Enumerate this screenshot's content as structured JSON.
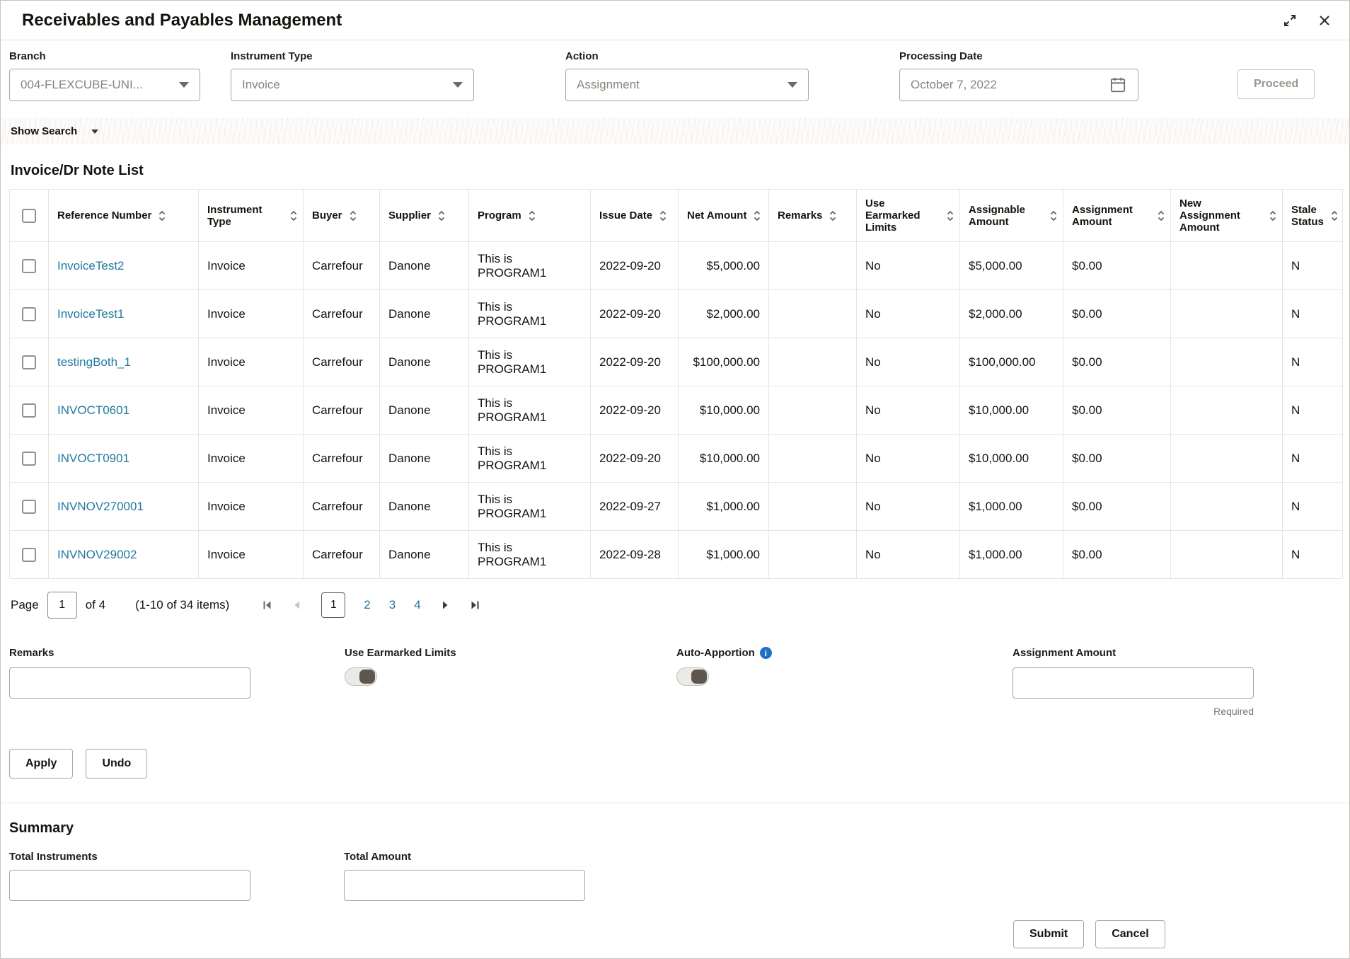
{
  "window": {
    "title": "Receivables and Payables Management"
  },
  "filters": {
    "branch": {
      "label": "Branch",
      "value": "004-FLEXCUBE-UNI..."
    },
    "instrument_type": {
      "label": "Instrument Type",
      "value": "Invoice"
    },
    "action": {
      "label": "Action",
      "value": "Assignment"
    },
    "processing_date": {
      "label": "Processing Date",
      "value": "October 7, 2022"
    },
    "proceed_label": "Proceed"
  },
  "show_search_label": "Show Search",
  "list": {
    "title": "Invoice/Dr Note List",
    "columns": [
      "Reference Number",
      "Instrument Type",
      "Buyer",
      "Supplier",
      "Program",
      "Issue Date",
      "Net Amount",
      "Remarks",
      "Use Earmarked Limits",
      "Assignable Amount",
      "Assignment Amount",
      "New Assignment Amount",
      "Stale Status"
    ],
    "rows": [
      {
        "reference": "InvoiceTest2",
        "instrument_type": "Invoice",
        "buyer": "Carrefour",
        "supplier": "Danone",
        "program": "This is PROGRAM1",
        "issue_date": "2022-09-20",
        "net_amount": "$5,000.00",
        "remarks": "",
        "use_earmarked_limits": "No",
        "assignable_amount": "$5,000.00",
        "assignment_amount": "$0.00",
        "new_assignment_amount": "",
        "stale_status": "N"
      },
      {
        "reference": "InvoiceTest1",
        "instrument_type": "Invoice",
        "buyer": "Carrefour",
        "supplier": "Danone",
        "program": "This is PROGRAM1",
        "issue_date": "2022-09-20",
        "net_amount": "$2,000.00",
        "remarks": "",
        "use_earmarked_limits": "No",
        "assignable_amount": "$2,000.00",
        "assignment_amount": "$0.00",
        "new_assignment_amount": "",
        "stale_status": "N"
      },
      {
        "reference": "testingBoth_1",
        "instrument_type": "Invoice",
        "buyer": "Carrefour",
        "supplier": "Danone",
        "program": "This is PROGRAM1",
        "issue_date": "2022-09-20",
        "net_amount": "$100,000.00",
        "remarks": "",
        "use_earmarked_limits": "No",
        "assignable_amount": "$100,000.00",
        "assignment_amount": "$0.00",
        "new_assignment_amount": "",
        "stale_status": "N"
      },
      {
        "reference": "INVOCT0601",
        "instrument_type": "Invoice",
        "buyer": "Carrefour",
        "supplier": "Danone",
        "program": "This is PROGRAM1",
        "issue_date": "2022-09-20",
        "net_amount": "$10,000.00",
        "remarks": "",
        "use_earmarked_limits": "No",
        "assignable_amount": "$10,000.00",
        "assignment_amount": "$0.00",
        "new_assignment_amount": "",
        "stale_status": "N"
      },
      {
        "reference": "INVOCT0901",
        "instrument_type": "Invoice",
        "buyer": "Carrefour",
        "supplier": "Danone",
        "program": "This is PROGRAM1",
        "issue_date": "2022-09-20",
        "net_amount": "$10,000.00",
        "remarks": "",
        "use_earmarked_limits": "No",
        "assignable_amount": "$10,000.00",
        "assignment_amount": "$0.00",
        "new_assignment_amount": "",
        "stale_status": "N"
      },
      {
        "reference": "INVNOV270001",
        "instrument_type": "Invoice",
        "buyer": "Carrefour",
        "supplier": "Danone",
        "program": "This is PROGRAM1",
        "issue_date": "2022-09-27",
        "net_amount": "$1,000.00",
        "remarks": "",
        "use_earmarked_limits": "No",
        "assignable_amount": "$1,000.00",
        "assignment_amount": "$0.00",
        "new_assignment_amount": "",
        "stale_status": "N"
      },
      {
        "reference": "INVNOV29002",
        "instrument_type": "Invoice",
        "buyer": "Carrefour",
        "supplier": "Danone",
        "program": "This is PROGRAM1",
        "issue_date": "2022-09-28",
        "net_amount": "$1,000.00",
        "remarks": "",
        "use_earmarked_limits": "No",
        "assignable_amount": "$1,000.00",
        "assignment_amount": "$0.00",
        "new_assignment_amount": "",
        "stale_status": "N"
      }
    ]
  },
  "pagination": {
    "page_label": "Page",
    "current_page": "1",
    "of_label": "of 4",
    "items_label": "(1-10 of 34 items)",
    "pages": [
      "1",
      "2",
      "3",
      "4"
    ]
  },
  "form": {
    "remarks_label": "Remarks",
    "use_earmarked_limits_label": "Use Earmarked Limits",
    "auto_apportion_label": "Auto-Apportion",
    "assignment_amount_label": "Assignment Amount",
    "required_label": "Required",
    "apply_label": "Apply",
    "undo_label": "Undo"
  },
  "summary": {
    "title": "Summary",
    "total_instruments_label": "Total Instruments",
    "total_amount_label": "Total Amount"
  },
  "footer": {
    "submit_label": "Submit",
    "cancel_label": "Cancel"
  },
  "icons": {
    "info_glyph": "i"
  },
  "colors": {
    "link": "#2279a0",
    "info": "#1f6fc4",
    "toggle_knob": "#5f574f"
  }
}
